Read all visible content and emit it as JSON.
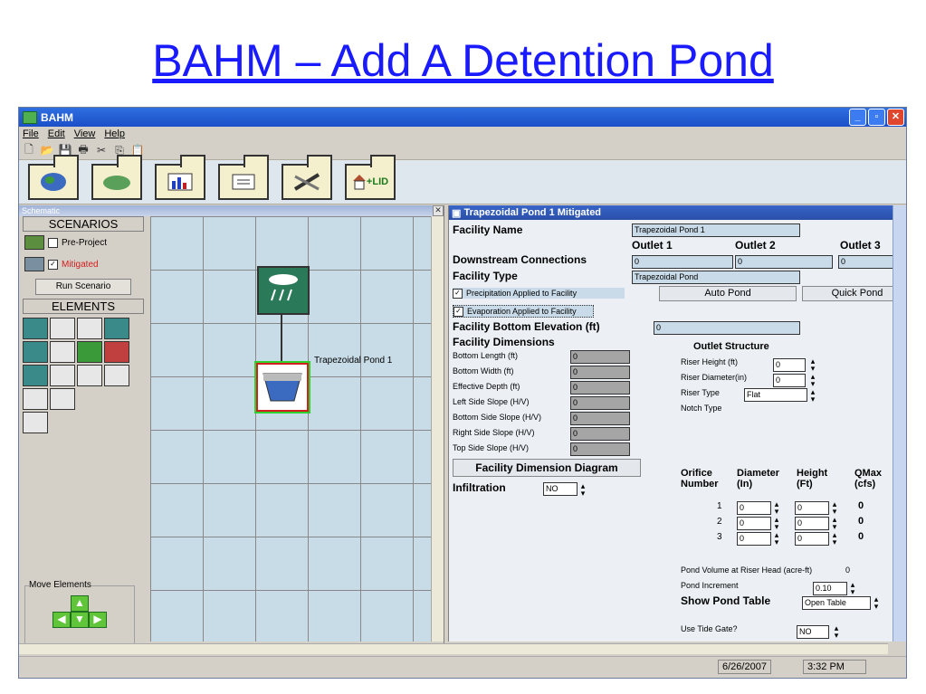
{
  "slide": {
    "title": "BAHM – Add A Detention Pond"
  },
  "window": {
    "title": "BAHM",
    "min": "_",
    "max": "▫",
    "close": "✕"
  },
  "menu": [
    "File",
    "Edit",
    "View",
    "Help"
  ],
  "big_toolbar": {
    "lid_label": "+LID"
  },
  "schematic": {
    "title": "Schematic",
    "close": "✕",
    "scenarios_header": "SCENARIOS",
    "scenarios": [
      {
        "label": "Pre-Project",
        "checked": false
      },
      {
        "label": "Mitigated",
        "checked": true
      }
    ],
    "run_button": "Run Scenario",
    "elements_header": "ELEMENTS",
    "move_elements": "Move Elements",
    "node_label": "Trapezoidal Pond  1"
  },
  "form": {
    "title": "Trapezoidal Pond  1 Mitigated",
    "facility_name_label": "Facility Name",
    "facility_name_value": "Trapezoidal Pond  1",
    "outlets": [
      "Outlet 1",
      "Outlet 2",
      "Outlet 3"
    ],
    "downstream_label": "Downstream Connections",
    "downstream_values": [
      "0",
      "0",
      "0"
    ],
    "facility_type_label": "Facility Type",
    "facility_type_value": "Trapezoidal Pond",
    "precip_label": "Precipitation Applied to Facility",
    "evap_label": "Evaporation Applied to Facility",
    "auto_pond": "Auto Pond",
    "quick_pond": "Quick Pond",
    "bottom_elev_label": "Facility Bottom Elevation (ft)",
    "bottom_elev_value": "0",
    "dims_label": "Facility Dimensions",
    "dims": [
      {
        "label": "Bottom Length (ft)",
        "value": "0"
      },
      {
        "label": "Bottom Width (ft)",
        "value": "0"
      },
      {
        "label": "Effective Depth (ft)",
        "value": "0"
      },
      {
        "label": "Left Side Slope (H/V)",
        "value": "0"
      },
      {
        "label": "Bottom Side Slope (H/V)",
        "value": "0"
      },
      {
        "label": "Right Side Slope (H/V)",
        "value": "0"
      },
      {
        "label": "Top Side Slope (H/V)",
        "value": "0"
      }
    ],
    "dim_diagram_button": "Facility Dimension Diagram",
    "infiltration_label": "Infiltration",
    "infiltration_value": "NO",
    "outlet_structure_label": "Outlet Structure",
    "riser_height_label": "Riser Height (ft)",
    "riser_height_value": "0",
    "riser_diameter_label": "Riser Diameter(in)",
    "riser_diameter_value": "0",
    "riser_type_label": "Riser Type",
    "riser_type_value": "Flat",
    "notch_type_label": "Notch Type",
    "orifice_headers": {
      "number": "Orifice\nNumber",
      "diameter": "Diameter\n(In)",
      "height": "Height\n(Ft)",
      "qmax": "QMax\n(cfs)"
    },
    "orifices": [
      {
        "num": "1",
        "diameter": "0",
        "height": "0",
        "qmax": "0"
      },
      {
        "num": "2",
        "diameter": "0",
        "height": "0",
        "qmax": "0"
      },
      {
        "num": "3",
        "diameter": "0",
        "height": "0",
        "qmax": "0"
      }
    ],
    "pond_volume_label": "Pond Volume at Riser Head (acre-ft)",
    "pond_volume_value": "0",
    "pond_increment_label": "Pond Increment",
    "pond_increment_value": "0.10",
    "show_pond_table_label": "Show Pond Table",
    "open_table": "Open Table",
    "tide_gate_label": "Use Tide Gate?",
    "tide_gate_value": "NO"
  },
  "status": {
    "date": "6/26/2007",
    "time": "3:32 PM"
  }
}
